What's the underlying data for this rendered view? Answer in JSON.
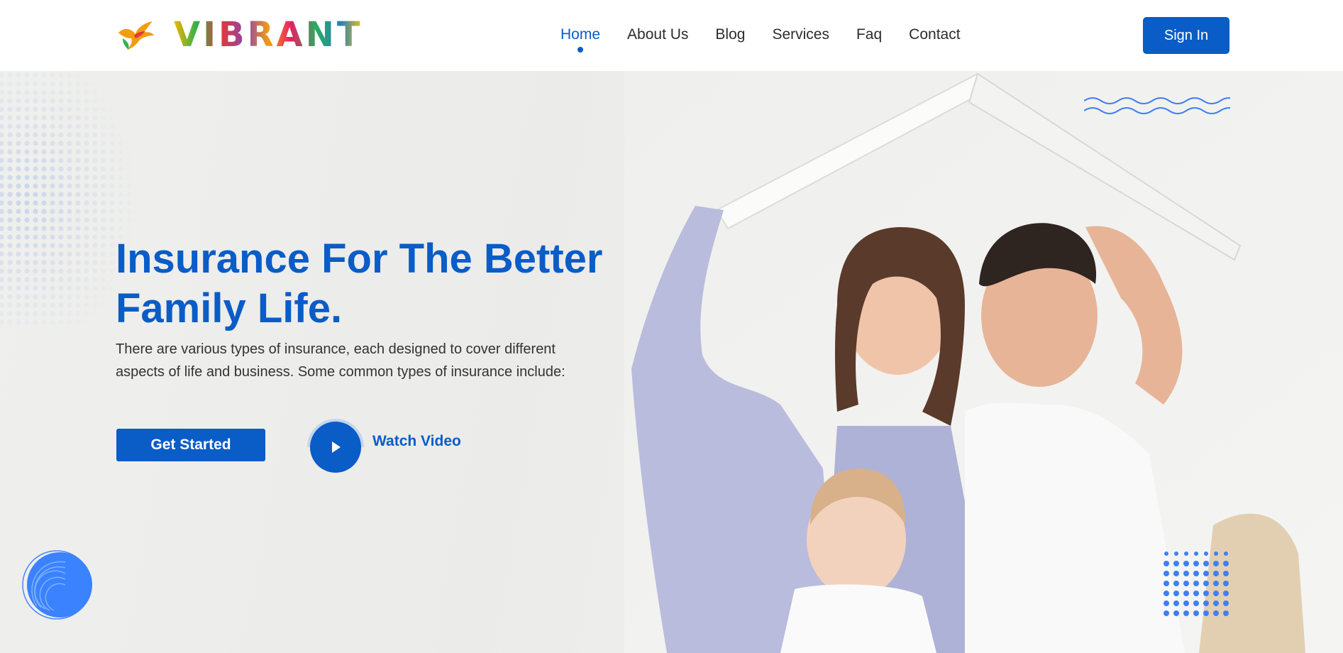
{
  "brand": {
    "name": "VIBRANT",
    "logo_icon": "phoenix-logo-icon"
  },
  "nav": {
    "items": [
      {
        "label": "Home",
        "active": true
      },
      {
        "label": "About Us",
        "active": false
      },
      {
        "label": "Blog",
        "active": false
      },
      {
        "label": "Services",
        "active": false
      },
      {
        "label": "Faq",
        "active": false
      },
      {
        "label": "Contact",
        "active": false
      }
    ],
    "signin_label": "Sign In"
  },
  "hero": {
    "headline_line1": "Insurance For The Better",
    "headline_line2": "Family Life.",
    "description_line1": "There are various types of insurance, each designed to cover different",
    "description_line2": "aspects of life and business. Some common types of insurance include:",
    "cta_label": "Get Started",
    "video_label": "Watch Video",
    "video_icon": "play-icon",
    "image": "family-under-roof-photo"
  },
  "colors": {
    "primary": "#0a5cc7",
    "accent_light": "#4a86ff",
    "text": "#2c2c2c",
    "hero_bg": "#efefed"
  }
}
